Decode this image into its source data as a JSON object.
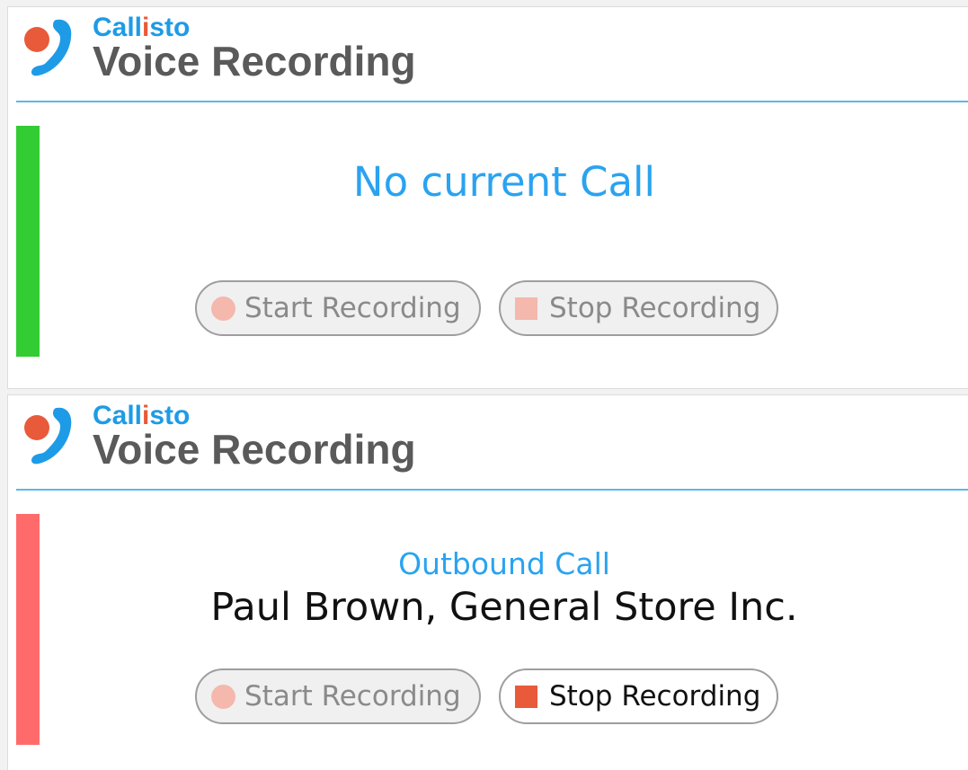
{
  "brand": {
    "name_prefix": "Call",
    "name_accent": "i",
    "name_suffix": "sto",
    "app_title": "Voice Recording"
  },
  "colors": {
    "brand_blue": "#1e9be6",
    "brand_orange": "#e85a3a",
    "idle_indicator": "#33cc33",
    "active_indicator": "#ff6b6b",
    "start_icon_disabled": "#f4b8ad",
    "stop_icon_disabled": "#f4b8ad",
    "stop_icon_enabled": "#e85a3a"
  },
  "panels": [
    {
      "state": "idle",
      "call_status": "No current Call",
      "caller": "",
      "start_label": "Start Recording",
      "stop_label": "Stop Recording",
      "start_enabled": false,
      "stop_enabled": false
    },
    {
      "state": "active",
      "call_status": "Outbound Call",
      "caller": "Paul Brown, General Store Inc.",
      "start_label": "Start Recording",
      "stop_label": "Stop Recording",
      "start_enabled": false,
      "stop_enabled": true
    }
  ]
}
